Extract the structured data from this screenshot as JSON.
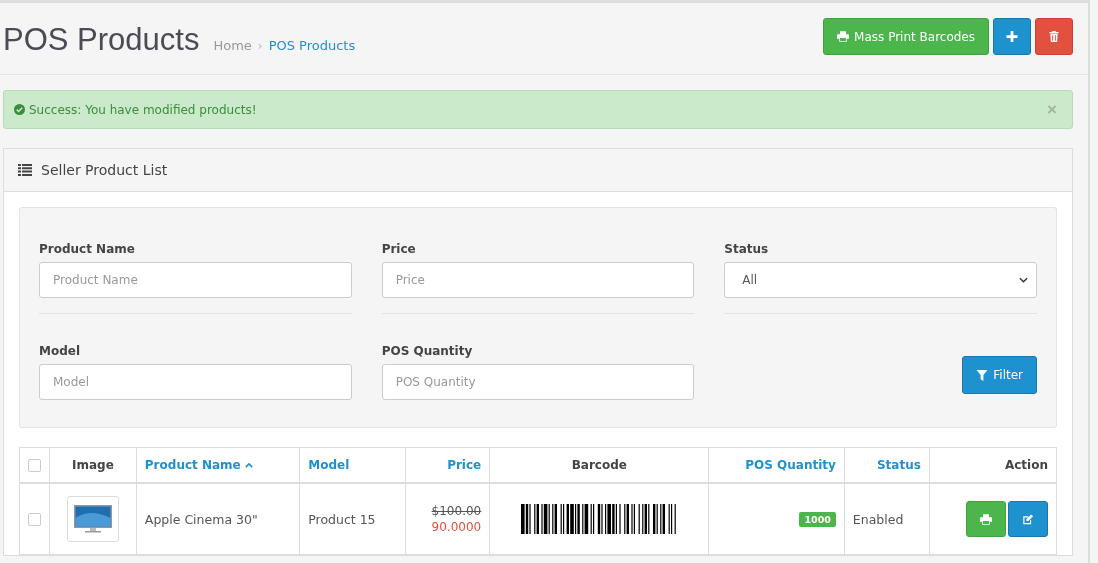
{
  "header": {
    "title": "POS Products",
    "breadcrumb_separator": "›",
    "breadcrumb": [
      {
        "label": "Home",
        "current": false
      },
      {
        "label": "POS Products",
        "current": true
      }
    ],
    "buttons": [
      {
        "kind": "print",
        "label": "Mass Print Barcodes"
      },
      {
        "kind": "add"
      },
      {
        "kind": "delete"
      }
    ]
  },
  "alert": {
    "text": "Success: You have modified products!",
    "close": "×"
  },
  "panel": {
    "title": "Seller Product List",
    "filters": [
      {
        "kind": "text",
        "label": "Product Name",
        "placeholder": "Product Name"
      },
      {
        "kind": "text",
        "label": "Price",
        "placeholder": "Price"
      },
      {
        "kind": "select",
        "label": "Status",
        "value": "All"
      },
      {
        "kind": "text",
        "label": "Model",
        "placeholder": "Model"
      },
      {
        "kind": "text",
        "label": "POS Quantity",
        "placeholder": "POS Quantity"
      }
    ],
    "filter_button": "Filter",
    "table": {
      "select_all_checked": false,
      "columns": [
        {
          "label": "Image",
          "sortable": false,
          "sorted": false
        },
        {
          "label": "Product Name",
          "sortable": true,
          "sorted": true
        },
        {
          "label": "Model",
          "sortable": true,
          "sorted": false
        },
        {
          "label": "Price",
          "sortable": true,
          "sorted": false
        },
        {
          "label": "Barcode",
          "sortable": false,
          "sorted": false
        },
        {
          "label": "POS Quantity",
          "sortable": true,
          "sorted": false
        },
        {
          "label": "Status",
          "sortable": true,
          "sorted": false
        },
        {
          "label": "Action",
          "sortable": false,
          "sorted": false
        }
      ],
      "rows": [
        {
          "checked": false,
          "name": "Apple Cinema 30\"",
          "model": "Product 15",
          "old_price": "$100.00",
          "price": "90.0000",
          "quantity": "1000",
          "status": "Enabled"
        }
      ]
    }
  }
}
